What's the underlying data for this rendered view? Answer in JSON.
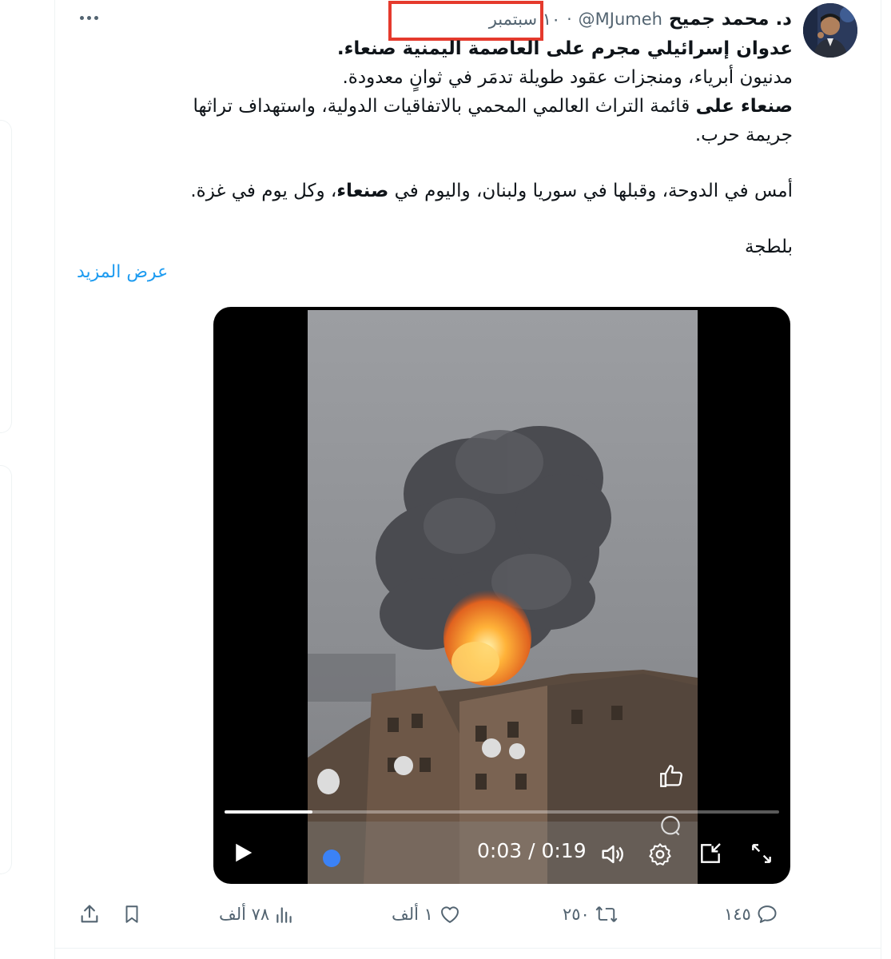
{
  "tweet": {
    "author_name": "د. محمد جميح",
    "handle": "@MJumeh",
    "separator": "·",
    "date": "١٠ سبتمبر",
    "text_lines": {
      "l1": "عدوان إسرائيلي مجرم على العاصمة اليمنية صنعاء.",
      "l2": "مدنيون أبرياء، ومنجزات عقود طويلة تدمَر في ثوانٍ معدودة.",
      "l3_bold": "صنعاء على",
      "l3_rest": " قائمة التراث العالمي المحمي بالاتفاقيات الدولية، واستهداف تراثها",
      "l4": "جريمة حرب.",
      "l5_a": "أمس في الدوحة، وقبلها في سوريا ولبنان، واليوم في ",
      "l5_bold": "صنعاء",
      "l5_b": "، وكل يوم في غزة.",
      "l6": "بلطجة"
    },
    "show_more": "عرض المزيد"
  },
  "video": {
    "time_display": "0:03 / 0:19",
    "progress_fraction": 0.158,
    "icons": [
      "play-icon",
      "volume-icon",
      "settings-icon",
      "pip-icon",
      "fullscreen-icon",
      "thumbs-up-icon",
      "comment-icon"
    ]
  },
  "actions": {
    "replies": "١٤٥",
    "reposts": "٢٥٠",
    "likes": "١ ألف",
    "views": "٧٨ ألف"
  },
  "colors": {
    "accent": "#1d9bf0",
    "muted": "#536471",
    "highlight": "#e53a2d"
  }
}
